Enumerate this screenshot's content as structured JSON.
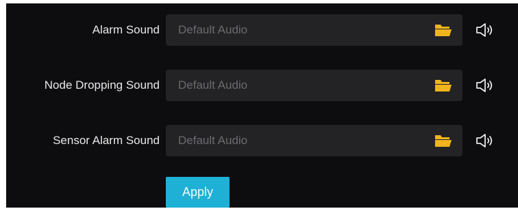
{
  "sounds": [
    {
      "label": "Alarm Sound",
      "value": "Default Audio",
      "browse_icon": "folder-icon",
      "play_icon": "speaker-icon"
    },
    {
      "label": "Node Dropping Sound",
      "value": "Default Audio",
      "browse_icon": "folder-icon",
      "play_icon": "speaker-icon"
    },
    {
      "label": "Sensor Alarm Sound",
      "value": "Default Audio",
      "browse_icon": "folder-icon",
      "play_icon": "speaker-icon"
    }
  ],
  "apply_label": "Apply",
  "colors": {
    "panel_background": "#0d0d0f",
    "field_background": "#232326",
    "folder_icon": "#f0b41c",
    "apply_button": "#1fb0d6"
  }
}
